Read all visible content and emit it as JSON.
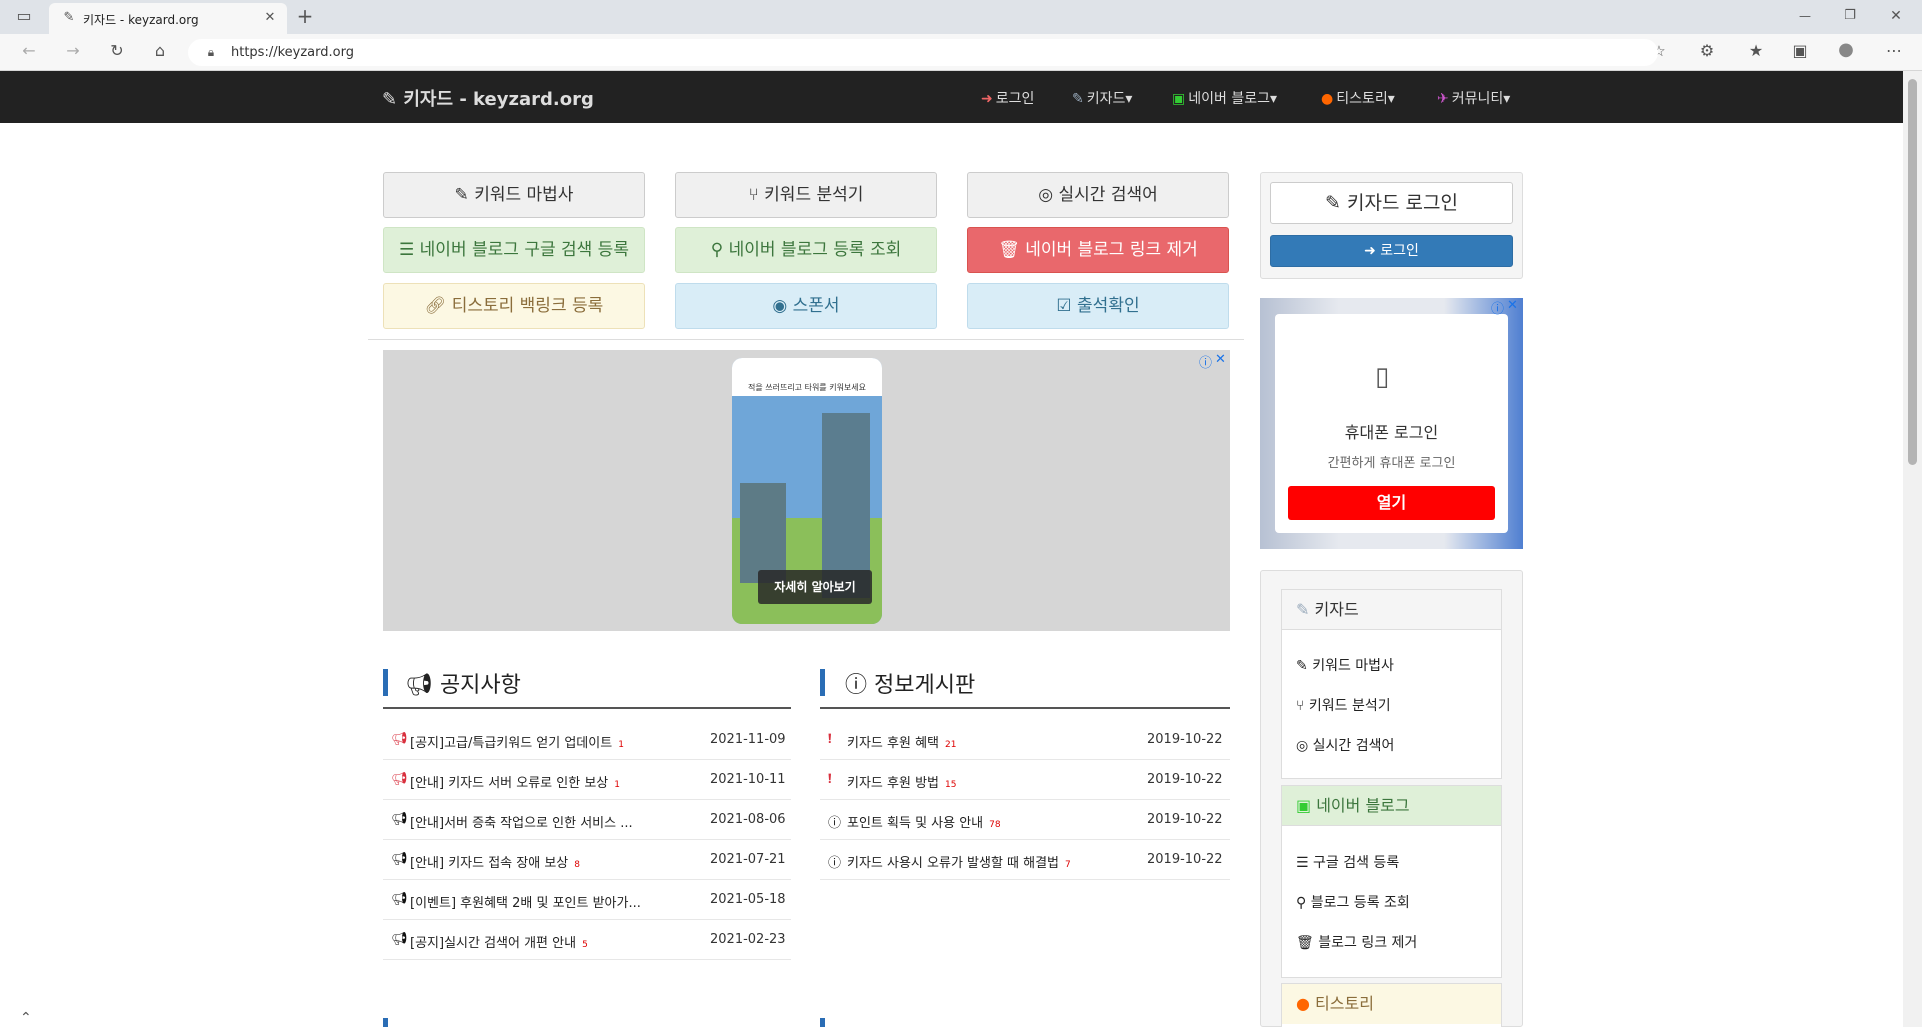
{
  "browser": {
    "tab_title": "키자드 - keyzard.org",
    "url": "https://keyzard.org",
    "new_tab": "+",
    "minimize": "—",
    "restore": "❐",
    "close": "✕"
  },
  "navbar": {
    "brand": "키자드 - keyzard.org",
    "items": [
      {
        "label": "로그인"
      },
      {
        "label": "키자드"
      },
      {
        "label": "네이버 블로그"
      },
      {
        "label": "티스토리"
      },
      {
        "label": "커뮤니티"
      }
    ]
  },
  "buttons": [
    {
      "label": "키워드 마법사"
    },
    {
      "label": "키워드 분석기"
    },
    {
      "label": "실시간 검색어"
    },
    {
      "label": "네이버 블로그 구글 검색 등록"
    },
    {
      "label": "네이버 블로그 등록 조회"
    },
    {
      "label": "네이버 블로그 링크 제거"
    },
    {
      "label": "티스토리 백링크 등록"
    },
    {
      "label": "스폰서"
    },
    {
      "label": "출석확인"
    }
  ],
  "ad_main": {
    "caption": "적을 쓰러뜨리고 타워를 키워보세요",
    "cta": "자세히 알아보기"
  },
  "notice_board": {
    "title": "공지사항",
    "rows": [
      {
        "title": "[공지]고급/특급키워드 얻기 업데이트",
        "count": "1",
        "date": "2021-11-09",
        "hot": true
      },
      {
        "title": "[안내] 키자드 서버 오류로 인한 보상",
        "count": "1",
        "date": "2021-10-11",
        "hot": true
      },
      {
        "title": "[안내]서버 증축 작업으로 인한 서비스 ...",
        "count": "",
        "date": "2021-08-06",
        "hot": false
      },
      {
        "title": "[안내] 키자드 접속 장애 보상",
        "count": "8",
        "date": "2021-07-21",
        "hot": false
      },
      {
        "title": "[이벤트] 후원혜택 2배 및 포인트 받아가...",
        "count": "",
        "date": "2021-05-18",
        "hot": false
      },
      {
        "title": "[공지]실시간 검색어 개편 안내",
        "count": "5",
        "date": "2021-02-23",
        "hot": false
      }
    ]
  },
  "info_board": {
    "title": "정보게시판",
    "rows": [
      {
        "title": "키자드 후원 혜택",
        "count": "21",
        "date": "2019-10-22",
        "hot": true
      },
      {
        "title": "키자드 후원 방법",
        "count": "15",
        "date": "2019-10-22",
        "hot": true
      },
      {
        "title": "포인트 획득 및 사용 안내",
        "count": "78",
        "date": "2019-10-22",
        "hot": false
      },
      {
        "title": "키자드 사용시 오류가 발생할 때 해결법",
        "count": "7",
        "date": "2019-10-22",
        "hot": false
      }
    ]
  },
  "sidebar": {
    "login_title": "키자드 로그인",
    "login_button": "로그인",
    "ad": {
      "heading": "휴대폰 로그인",
      "subtext": "간편하게 휴대폰 로그인",
      "button": "열기"
    },
    "sections": [
      {
        "title": "키자드",
        "items": [
          "키워드 마법사",
          "키워드 분석기",
          "실시간 검색어"
        ]
      },
      {
        "title": "네이버 블로그",
        "items": [
          "구글 검색 등록",
          "블로그 등록 조회",
          "블로그 링크 제거"
        ]
      },
      {
        "title": "티스토리",
        "items": []
      }
    ]
  },
  "colors": {
    "navbar": "#222222",
    "primary": "#337ab7",
    "danger": "#d9534f",
    "accent_bar": "#2a6db5"
  }
}
